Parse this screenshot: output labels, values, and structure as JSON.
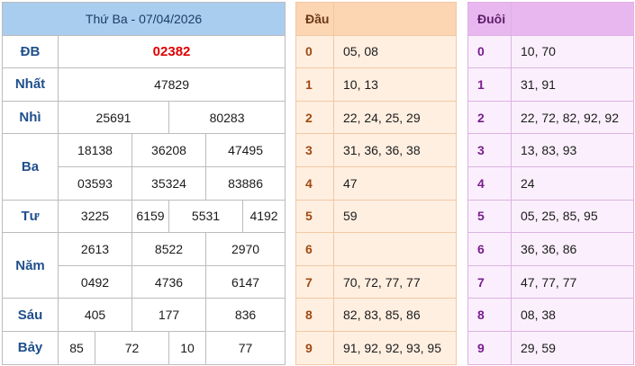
{
  "results": {
    "date_title": "Thứ Ba - 07/04/2026",
    "rows": [
      {
        "label": "ĐB",
        "values": [
          "02382"
        ]
      },
      {
        "label": "Nhất",
        "values": [
          "47829"
        ]
      },
      {
        "label": "Nhì",
        "values": [
          "25691",
          "80283"
        ]
      },
      {
        "label": "Ba",
        "values": [
          "18138",
          "36208",
          "47495",
          "03593",
          "35324",
          "83886"
        ]
      },
      {
        "label": "Tư",
        "values": [
          "3225",
          "6159",
          "5531",
          "4192"
        ]
      },
      {
        "label": "Năm",
        "values": [
          "2613",
          "8522",
          "2970",
          "0492",
          "4736",
          "6147"
        ]
      },
      {
        "label": "Sáu",
        "values": [
          "405",
          "177",
          "836"
        ]
      },
      {
        "label": "Bảy",
        "values": [
          "85",
          "72",
          "10",
          "77"
        ]
      }
    ]
  },
  "head": {
    "title": "Đầu",
    "rows": [
      {
        "key": "0",
        "value": "05, 08"
      },
      {
        "key": "1",
        "value": "10, 13"
      },
      {
        "key": "2",
        "value": "22, 24, 25, 29"
      },
      {
        "key": "3",
        "value": "31, 36, 36, 38"
      },
      {
        "key": "4",
        "value": "47"
      },
      {
        "key": "5",
        "value": "59"
      },
      {
        "key": "6",
        "value": ""
      },
      {
        "key": "7",
        "value": "70, 72, 77, 77"
      },
      {
        "key": "8",
        "value": "82, 83, 85, 86"
      },
      {
        "key": "9",
        "value": "91, 92, 92, 93, 95"
      }
    ]
  },
  "tail": {
    "title": "Đuôi",
    "rows": [
      {
        "key": "0",
        "value": "10, 70"
      },
      {
        "key": "1",
        "value": "31, 91"
      },
      {
        "key": "2",
        "value": "22, 72, 82, 92, 92"
      },
      {
        "key": "3",
        "value": "13, 83, 93"
      },
      {
        "key": "4",
        "value": "24"
      },
      {
        "key": "5",
        "value": "05, 25, 85, 95"
      },
      {
        "key": "6",
        "value": "36, 36, 86"
      },
      {
        "key": "7",
        "value": "47, 77, 77"
      },
      {
        "key": "8",
        "value": "08, 38"
      },
      {
        "key": "9",
        "value": "29, 59"
      }
    ]
  },
  "colors": {
    "special_prize": "#e00000",
    "results_header": "#a9cdee",
    "head_header": "#fcd5b3",
    "tail_header": "#e9b7ef"
  }
}
